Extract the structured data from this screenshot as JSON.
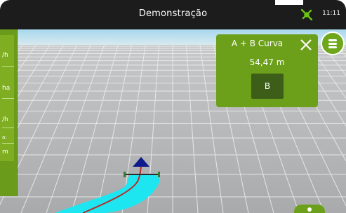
{
  "header": {
    "title": "Demonstração",
    "time": "11:11",
    "gps_icon": "gps-satellite-icon"
  },
  "side_panel": {
    "labels": [
      "/h",
      "ha",
      "/h",
      "a:",
      "m"
    ]
  },
  "aplus_card": {
    "title": "A + B Curva",
    "distance": "54,47 m",
    "button_label": "B"
  },
  "colors": {
    "topbar": "#1c1c1c",
    "panel_green": "#6da01a",
    "button_dark_green": "#3d5e18",
    "sky": "#9fd3ea",
    "ground": "#b7b8b9",
    "coverage_cyan": "#1ee6f0",
    "guidance_line": "#c0392b",
    "vehicle_marker": "#101a8a"
  },
  "icons": {
    "close": "close-icon",
    "menu": "hamburger-menu-icon"
  }
}
